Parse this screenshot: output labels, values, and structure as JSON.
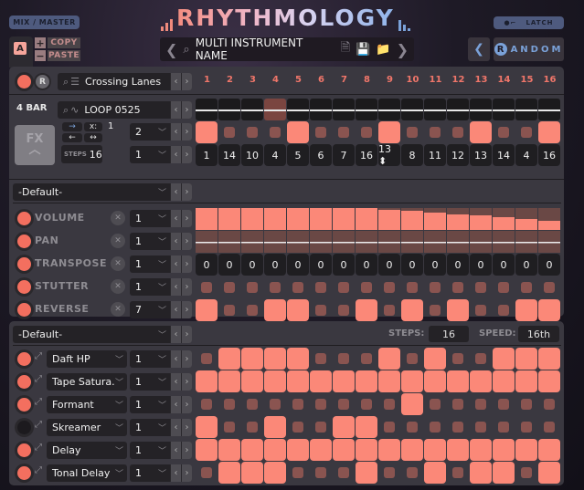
{
  "header": {
    "mix_master_label": "MIX / MASTER",
    "logo_text": "RHYTHMOLOGY",
    "latch_label": "LATCH",
    "a_button": "A",
    "copy_label": "COPY",
    "paste_label": "PASTE",
    "plus_icon": "+",
    "minus_icon": "−",
    "multi_instrument_name": "MULTI INSTRUMENT NAME",
    "random_label": "ANDOM",
    "random_badge": "R",
    "random_prev": "❮"
  },
  "sequencer": {
    "r_button": "R",
    "pattern_name": "Crossing Lanes",
    "bar_label": "4 BAR",
    "loop_name": "LOOP 0525",
    "x_label": "x:",
    "x_value": "1",
    "steps_label": "STEPS",
    "steps_value": "16",
    "select1_value": "2",
    "select2_value": "1",
    "fx_label": "FX",
    "step_numbers": [
      "1",
      "2",
      "3",
      "4",
      "5",
      "6",
      "7",
      "8",
      "9",
      "10",
      "11",
      "12",
      "13",
      "14",
      "15",
      "16"
    ],
    "selected_wave_step": 4,
    "triggers": [
      true,
      false,
      false,
      false,
      true,
      false,
      false,
      false,
      true,
      false,
      false,
      false,
      true,
      false,
      false,
      true
    ],
    "slice_order": [
      "1",
      "14",
      "10",
      "4",
      "5",
      "6",
      "7",
      "16",
      "13 ⬍",
      "8",
      "11",
      "12",
      "13",
      "14",
      "4",
      "16"
    ]
  },
  "modulation": {
    "preset": "-Default-",
    "rows": [
      {
        "label": "VOLUME",
        "value": "1",
        "enabled": true
      },
      {
        "label": "PAN",
        "value": "1",
        "enabled": true
      },
      {
        "label": "TRANSPOSE",
        "value": "1",
        "enabled": true
      },
      {
        "label": "STUTTER",
        "value": "1",
        "enabled": true
      },
      {
        "label": "REVERSE",
        "value": "7",
        "enabled": true
      }
    ],
    "volume_levels": [
      1,
      1,
      1,
      1,
      1,
      1,
      1,
      1,
      0.93,
      0.86,
      0.8,
      0.72,
      0.65,
      0.58,
      0.5,
      0.43
    ],
    "pan_values": [
      0,
      0,
      0,
      0,
      0,
      0,
      0,
      0,
      0,
      0,
      0,
      0,
      0,
      0,
      0,
      0
    ],
    "transpose_values": [
      "0",
      "0",
      "0",
      "0",
      "0",
      "0",
      "0",
      "0",
      "0",
      "0",
      "0",
      "0",
      "0",
      "0",
      "0",
      "0"
    ],
    "stutter": [
      false,
      false,
      false,
      false,
      false,
      false,
      false,
      false,
      false,
      false,
      false,
      false,
      false,
      false,
      false,
      false
    ],
    "reverse": [
      true,
      false,
      false,
      true,
      true,
      false,
      false,
      true,
      false,
      true,
      false,
      true,
      false,
      false,
      true,
      true
    ]
  },
  "fx": {
    "preset": "-Default-",
    "steps_label": "STEPS:",
    "steps_value": "16",
    "speed_label": "SPEED:",
    "speed_value": "16th",
    "rows": [
      {
        "name": "Daft HP",
        "value": "1",
        "enabled": true,
        "steps": [
          false,
          true,
          true,
          true,
          true,
          false,
          false,
          false,
          true,
          false,
          true,
          false,
          false,
          true,
          true,
          true
        ]
      },
      {
        "name": "Tape Satura.",
        "value": "1",
        "enabled": true,
        "steps": [
          true,
          true,
          true,
          true,
          true,
          true,
          true,
          true,
          true,
          true,
          true,
          true,
          true,
          true,
          true,
          true
        ]
      },
      {
        "name": "Formant",
        "value": "1",
        "enabled": true,
        "steps": [
          false,
          false,
          false,
          false,
          false,
          false,
          false,
          false,
          false,
          true,
          false,
          false,
          false,
          false,
          false,
          false
        ]
      },
      {
        "name": "Skreamer",
        "value": "1",
        "enabled": false,
        "steps": [
          true,
          false,
          false,
          true,
          false,
          false,
          true,
          true,
          false,
          false,
          false,
          false,
          false,
          false,
          false,
          false
        ]
      },
      {
        "name": "Delay",
        "value": "1",
        "enabled": true,
        "steps": [
          true,
          true,
          true,
          true,
          true,
          true,
          true,
          true,
          true,
          true,
          true,
          true,
          true,
          true,
          true,
          true
        ]
      },
      {
        "name": "Tonal Delay",
        "value": "1",
        "enabled": true,
        "steps": [
          false,
          true,
          true,
          true,
          false,
          false,
          false,
          true,
          false,
          false,
          true,
          false,
          true,
          true,
          false,
          true
        ]
      }
    ]
  },
  "colors": {
    "accent": "#fb8878",
    "accent_dim": "#8a5450",
    "blue": "#7aa1d8"
  }
}
